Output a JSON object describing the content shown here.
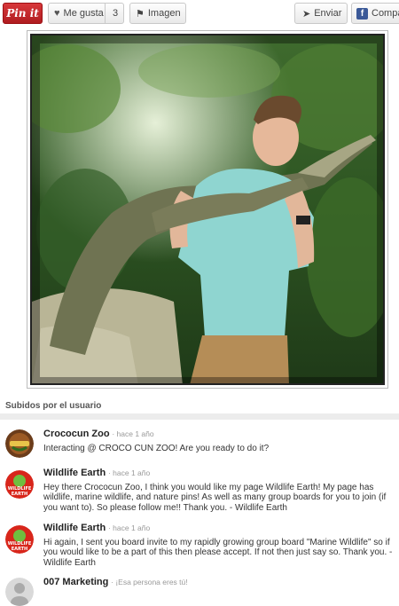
{
  "toolbar": {
    "pin_label": "Pin it",
    "like_label": "Me gusta",
    "like_count": "3",
    "image_label": "Imagen",
    "send_label": "Enviar",
    "share_label": "Compa"
  },
  "section": {
    "title": "Subidos por el usuario"
  },
  "comments": [
    {
      "name": "Crococun Zoo",
      "meta": "· hace 1 año",
      "text": "Interacting @ CROCO CUN ZOO! Are you ready to do it?"
    },
    {
      "name": "Wildlife Earth",
      "meta": "· hace 1 año",
      "text": "Hey there Crococun Zoo, I think you would like my page Wildlife Earth! My page has wildlife, marine wildlife, and nature pins! As well as many group boards for you to join (if you want to). So please follow me!! Thank you. - Wildlife Earth"
    },
    {
      "name": "Wildlife Earth",
      "meta": "· hace 1 año",
      "text": "Hi again, I sent you board invite to my rapidly growing group board \"Marine Wildlife\" so if you would like to be a part of this then please accept. If not then just say so. Thank you. - Wildlife Earth"
    },
    {
      "name": "007 Marketing",
      "meta": "· ¡Esa persona eres tú!",
      "text": ""
    }
  ],
  "avatars": {
    "wildlife_text_top": "WILDLIFE",
    "wildlife_text_bottom": "EARTH"
  }
}
